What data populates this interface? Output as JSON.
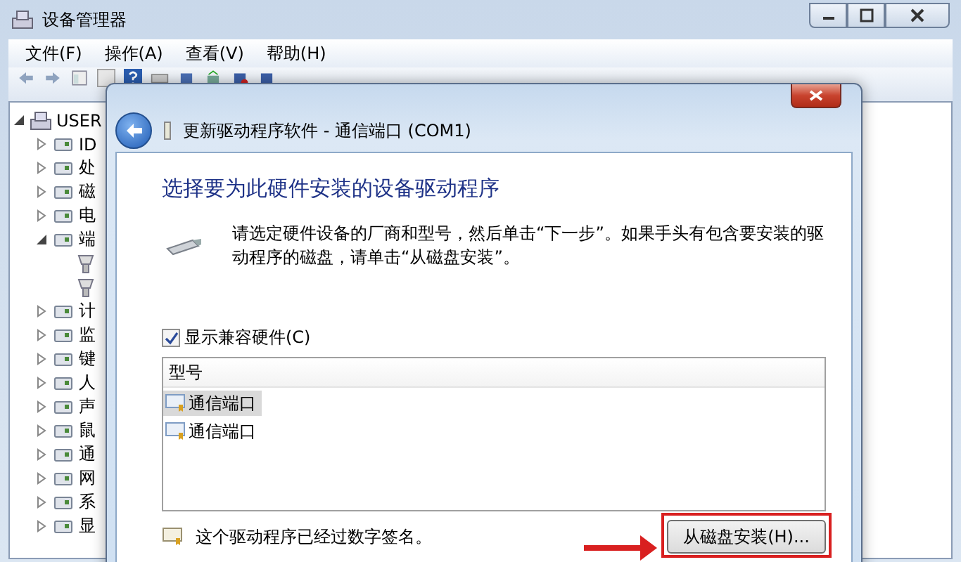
{
  "window": {
    "title": "设备管理器"
  },
  "menu": [
    {
      "label": "文件(F)"
    },
    {
      "label": "操作(A)"
    },
    {
      "label": "查看(V)"
    },
    {
      "label": "帮助(H)"
    }
  ],
  "device_tree": {
    "root": {
      "label": "USER",
      "expanded": true,
      "children": [
        {
          "label": "ID",
          "expanded": false
        },
        {
          "label": "处",
          "expanded": false
        },
        {
          "label": "磁",
          "expanded": false
        },
        {
          "label": "电",
          "expanded": false
        },
        {
          "label": "端",
          "expanded": true,
          "children": [
            {
              "kind": "port"
            },
            {
              "kind": "port"
            }
          ]
        },
        {
          "label": "计",
          "expanded": false
        },
        {
          "label": "监",
          "expanded": false
        },
        {
          "label": "键",
          "expanded": false
        },
        {
          "label": "人",
          "expanded": false
        },
        {
          "label": "声",
          "expanded": false
        },
        {
          "label": "鼠",
          "expanded": false
        },
        {
          "label": "通",
          "expanded": false
        },
        {
          "label": "网",
          "expanded": false
        },
        {
          "label": "系",
          "expanded": false
        },
        {
          "label": "显",
          "expanded": false
        }
      ]
    }
  },
  "dialog": {
    "title": "更新驱动程序软件 - 通信端口 (COM1)",
    "heading": "选择要为此硬件安装的设备驱动程序",
    "instruction": "请选定硬件设备的厂商和型号，然后单击“下一步”。如果手头有包含要安装的驱动程序的磁盘，请单击“从磁盘安装”。",
    "show_compatible": {
      "label": "显示兼容硬件(C)",
      "checked": true
    },
    "model_list": {
      "column": "型号",
      "items": [
        {
          "label": "通信端口",
          "selected": true
        },
        {
          "label": "通信端口",
          "selected": false
        }
      ]
    },
    "signature_note": "这个驱动程序已经过数字签名。",
    "disk_button": {
      "label": "从磁盘安装(H)...",
      "highlighted": true
    }
  }
}
